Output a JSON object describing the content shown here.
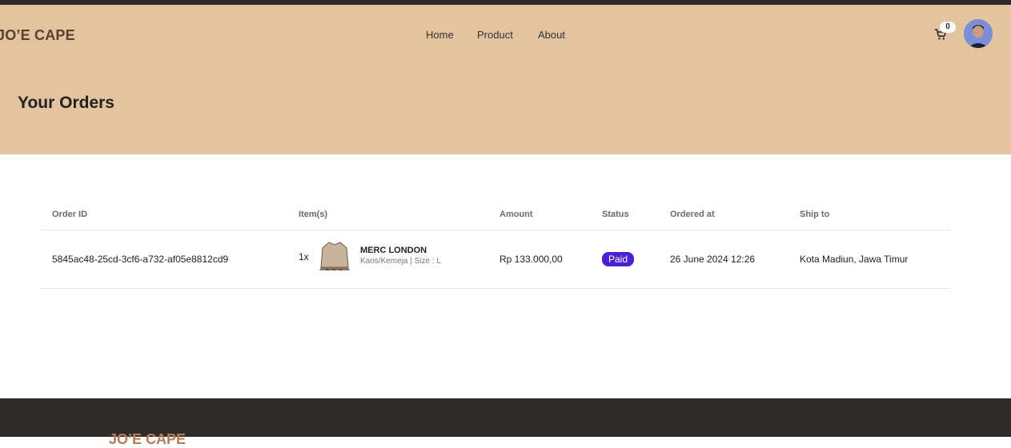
{
  "brand": {
    "logo": "JO’E CAPE"
  },
  "nav": {
    "items": [
      "Home",
      "Product",
      "About"
    ]
  },
  "cart": {
    "count": "0",
    "icon": "cart-icon"
  },
  "user": {
    "avatar": "user-avatar"
  },
  "page": {
    "title": "Your Orders"
  },
  "table": {
    "headers": [
      "Order ID",
      "Item(s)",
      "Amount",
      "Status",
      "Ordered at",
      "Ship to"
    ],
    "rows": [
      {
        "order_id": "5845ac48-25cd-3cf6-a732-af05e8812cd9",
        "qty": "1x",
        "item_name": "MERC LONDON",
        "item_meta": "Kaos/Kemeja | Size : L",
        "amount": "Rp 133.000,00",
        "status": "Paid",
        "ordered_at": "26 June 2024 12:26",
        "ship_to": "Kota Madiun, Jawa Timur"
      }
    ]
  },
  "footer": {
    "logo": "JO’E CAPE"
  },
  "colors": {
    "header_bg": "#e3c49f",
    "dark": "#2f2b29",
    "status_paid": "#4a1fd6",
    "brand_text": "#5b4230",
    "footer_logo": "#b57c58"
  }
}
